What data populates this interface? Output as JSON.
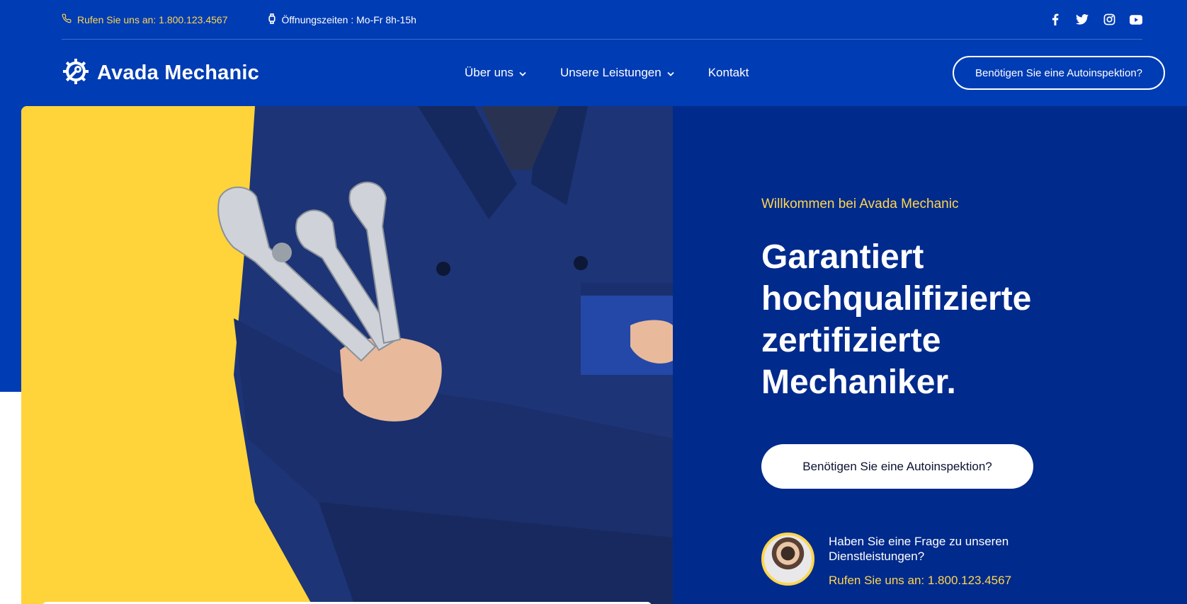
{
  "topbar": {
    "phone": "Rufen Sie uns an: 1.800.123.4567",
    "hours": "Öffnungszeiten : Mo-Fr 8h-15h",
    "socials": [
      "facebook-icon",
      "twitter-icon",
      "instagram-icon",
      "youtube-icon"
    ]
  },
  "nav": {
    "logo": "Avada Mechanic",
    "items": [
      {
        "label": "Über uns",
        "has_dropdown": true
      },
      {
        "label": "Unsere Leistungen",
        "has_dropdown": true
      },
      {
        "label": "Kontakt",
        "has_dropdown": false
      }
    ],
    "cta": "Benötigen Sie eine Autoinspektion?"
  },
  "hero": {
    "kicker": "Willkommen bei Avada Mechanic",
    "headline": "Garantiert hochqualifizierte zertifizierte Mechaniker.",
    "cta": "Benötigen Sie eine Autoinspektion?",
    "contact_question": "Haben Sie eine Frage zu unseren Dienstleistungen?",
    "contact_phone": "Rufen Sie uns an: 1.800.123.4567"
  },
  "colors": {
    "primary_blue": "#003cb4",
    "panel_blue": "#002a8c",
    "accent_yellow": "#ffd64f",
    "image_yellow": "#ffd43a",
    "uniform_navy": "#1d3476"
  }
}
